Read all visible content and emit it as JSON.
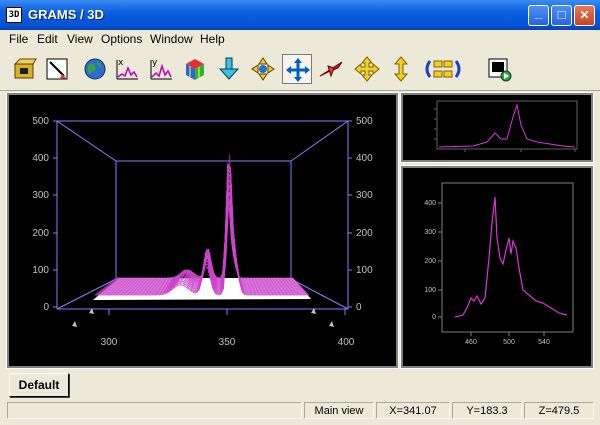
{
  "window": {
    "title": "GRAMS / 3D",
    "app_icon_text": "3D",
    "controls": {
      "minimize": "_",
      "maximize": "□",
      "close": "✕"
    }
  },
  "menu": [
    "File",
    "Edit",
    "View",
    "Options",
    "Window",
    "Help"
  ],
  "toolbar": {
    "tools": [
      "open-file-icon",
      "edit-icon",
      "globe-icon",
      "x-axis-icon",
      "y-axis-icon",
      "cube-icon",
      "down-arrow-icon",
      "rotate-icon",
      "move-icon",
      "plane-icon",
      "four-way-arrow-icon",
      "up-down-arrow-icon",
      "rotate-loop-icon",
      "export-icon"
    ],
    "pressed_tool": "move-icon"
  },
  "main_plot": {
    "y_ticks": [
      "500",
      "400",
      "300",
      "200",
      "100",
      "0"
    ],
    "y_ticks_right": [
      "500",
      "400",
      "300",
      "200",
      "100",
      "0"
    ],
    "x_ticks": [
      "300",
      "350",
      "400"
    ],
    "line_color": "#8080ff",
    "surface_color": "#cc44cc"
  },
  "side_plot": {
    "y_ticks": [
      "400",
      "300",
      "200",
      "100",
      "0"
    ],
    "x_ticks": [
      "460",
      "500",
      "540"
    ],
    "curve_color": "#dd33dd"
  },
  "tabs": [
    {
      "label": "Default"
    }
  ],
  "status": {
    "view": "Main view",
    "x": "X=341.07",
    "y": "Y=183.3",
    "z": "Z=479.5"
  }
}
